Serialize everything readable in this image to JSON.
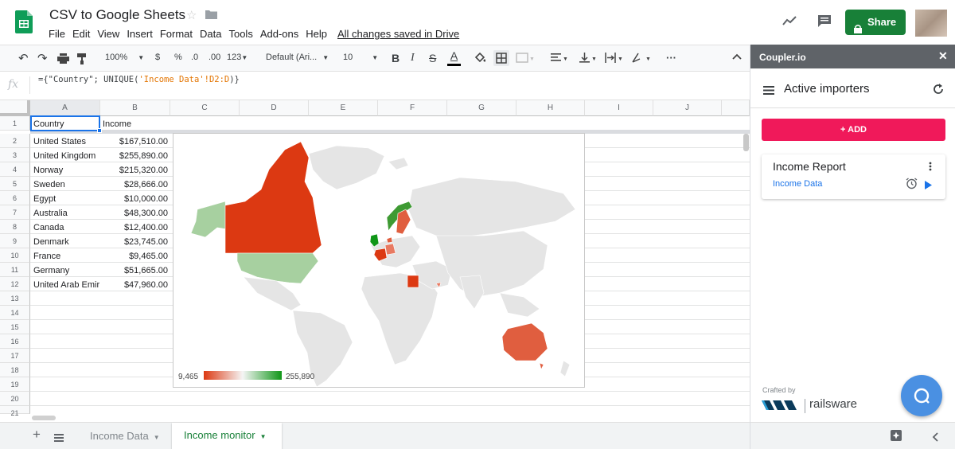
{
  "app": {
    "title": "CSV to Google Sheets",
    "menu": [
      "File",
      "Edit",
      "View",
      "Insert",
      "Format",
      "Data",
      "Tools",
      "Add-ons",
      "Help"
    ],
    "saved_status": "All changes saved in Drive",
    "share_label": "Share"
  },
  "toolbar": {
    "zoom": "100%",
    "currency": "$",
    "percent": "%",
    "dec_less": ".0",
    "dec_more": ".00",
    "format_more": "123",
    "font": "Default (Ari...",
    "font_size": "10",
    "bold": "B",
    "italic": "I",
    "strike": "S",
    "text_color": "A",
    "more": "···"
  },
  "formula_bar": {
    "fx": "fx",
    "formula_prefix": "={\"Country\"; UNIQUE(",
    "formula_range": "'Income Data'!D2:D",
    "formula_suffix": ")}"
  },
  "grid": {
    "columns": [
      "A",
      "B",
      "C",
      "D",
      "E",
      "F",
      "G",
      "H",
      "I",
      "J"
    ],
    "row_numbers": [
      "1",
      "2",
      "3",
      "4",
      "5",
      "6",
      "7",
      "8",
      "9",
      "10",
      "11",
      "12",
      "13",
      "14",
      "15",
      "16",
      "17",
      "18",
      "19",
      "20",
      "21"
    ],
    "header": {
      "a": "Country",
      "b": "Income"
    },
    "rows": [
      {
        "country": "United States",
        "income": "$167,510.00"
      },
      {
        "country": "United Kingdom",
        "income": "$255,890.00"
      },
      {
        "country": "Norway",
        "income": "$215,320.00"
      },
      {
        "country": "Sweden",
        "income": "$28,666.00"
      },
      {
        "country": "Egypt",
        "income": "$10,000.00"
      },
      {
        "country": "Australia",
        "income": "$48,300.00"
      },
      {
        "country": "Canada",
        "income": "$12,400.00"
      },
      {
        "country": "Denmark",
        "income": "$23,745.00"
      },
      {
        "country": "France",
        "income": "$9,465.00"
      },
      {
        "country": "Germany",
        "income": "$51,665.00"
      },
      {
        "country": "United Arab Emir",
        "income": "$47,960.00"
      }
    ]
  },
  "chart": {
    "legend_min": "9,465",
    "legend_max": "255,890",
    "color_low": "#dc3912",
    "color_mid": "#f5f5f5",
    "color_high": "#109618"
  },
  "tabs": {
    "items": [
      {
        "label": "Income Data",
        "active": false
      },
      {
        "label": "Income monitor",
        "active": true
      }
    ]
  },
  "panel": {
    "brand": "Coupler.io",
    "title": "Active importers",
    "add_label": "+ ADD",
    "importer_name": "Income Report",
    "importer_source": "Income Data",
    "crafted_by": "Crafted by",
    "company": "railsware"
  },
  "colors": {
    "sheets_green": "#0f9d58",
    "share_green": "#188038",
    "add_pink": "#f0195a",
    "link_blue": "#1a73e8",
    "chat_blue": "#4a90e2"
  }
}
